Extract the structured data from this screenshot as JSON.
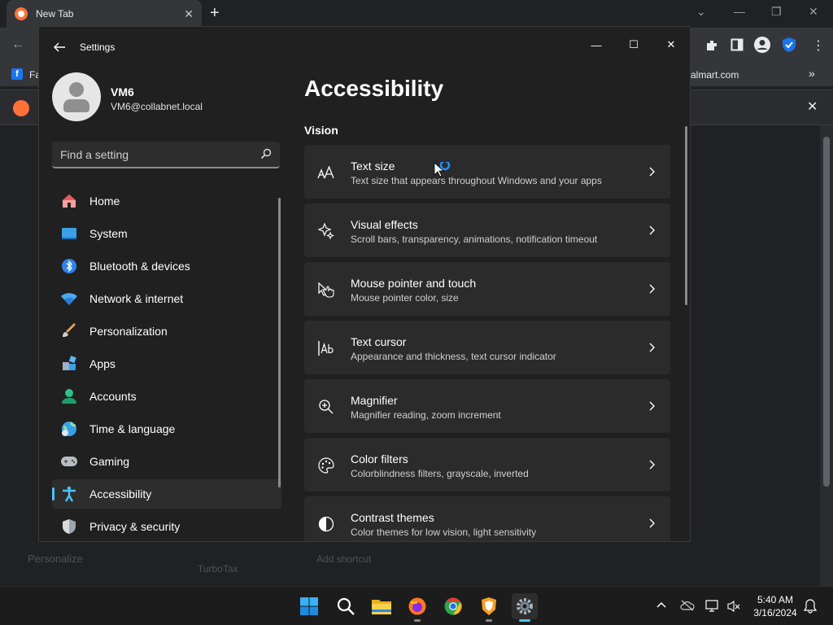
{
  "browser": {
    "tab_title": "New Tab",
    "bookmark_left": "Fa",
    "bookmark_right": "almart.com",
    "ghost_left": "Personalize",
    "ghost_mid": "TurboTax",
    "ghost_right": "Add shortcut"
  },
  "settings": {
    "window_title": "Settings",
    "profile": {
      "name": "VM6",
      "email": "VM6@collabnet.local"
    },
    "search": {
      "placeholder": "Find a setting"
    },
    "nav": [
      {
        "label": "Home",
        "icon": "home-icon"
      },
      {
        "label": "System",
        "icon": "system-icon"
      },
      {
        "label": "Bluetooth & devices",
        "icon": "bluetooth-icon"
      },
      {
        "label": "Network & internet",
        "icon": "wifi-icon"
      },
      {
        "label": "Personalization",
        "icon": "brush-icon"
      },
      {
        "label": "Apps",
        "icon": "apps-icon"
      },
      {
        "label": "Accounts",
        "icon": "account-icon"
      },
      {
        "label": "Time & language",
        "icon": "globe-icon"
      },
      {
        "label": "Gaming",
        "icon": "gamepad-icon"
      },
      {
        "label": "Accessibility",
        "icon": "accessibility-icon",
        "active": true
      },
      {
        "label": "Privacy & security",
        "icon": "shield-icon"
      }
    ],
    "page_title": "Accessibility",
    "section": "Vision",
    "cards": [
      {
        "title": "Text size",
        "subtitle": "Text size that appears throughout Windows and your apps",
        "icon": "text-size-icon"
      },
      {
        "title": "Visual effects",
        "subtitle": "Scroll bars, transparency, animations, notification timeout",
        "icon": "sparkle-icon"
      },
      {
        "title": "Mouse pointer and touch",
        "subtitle": "Mouse pointer color, size",
        "icon": "pointer-icon"
      },
      {
        "title": "Text cursor",
        "subtitle": "Appearance and thickness, text cursor indicator",
        "icon": "text-cursor-icon"
      },
      {
        "title": "Magnifier",
        "subtitle": "Magnifier reading, zoom increment",
        "icon": "magnifier-icon"
      },
      {
        "title": "Color filters",
        "subtitle": "Colorblindness filters, grayscale, inverted",
        "icon": "palette-icon"
      },
      {
        "title": "Contrast themes",
        "subtitle": "Color themes for low vision, light sensitivity",
        "icon": "contrast-icon"
      }
    ]
  },
  "taskbar": {
    "time": "5:40 AM",
    "date": "3/16/2024",
    "apps": [
      "start-icon",
      "search-icon",
      "file-explorer-icon",
      "firefox-icon",
      "chrome-icon",
      "brave-icon",
      "settings-icon"
    ]
  },
  "colors": {
    "accent": "#4cc2ff",
    "window_bg": "#202020",
    "card_bg": "#2b2b2b"
  }
}
